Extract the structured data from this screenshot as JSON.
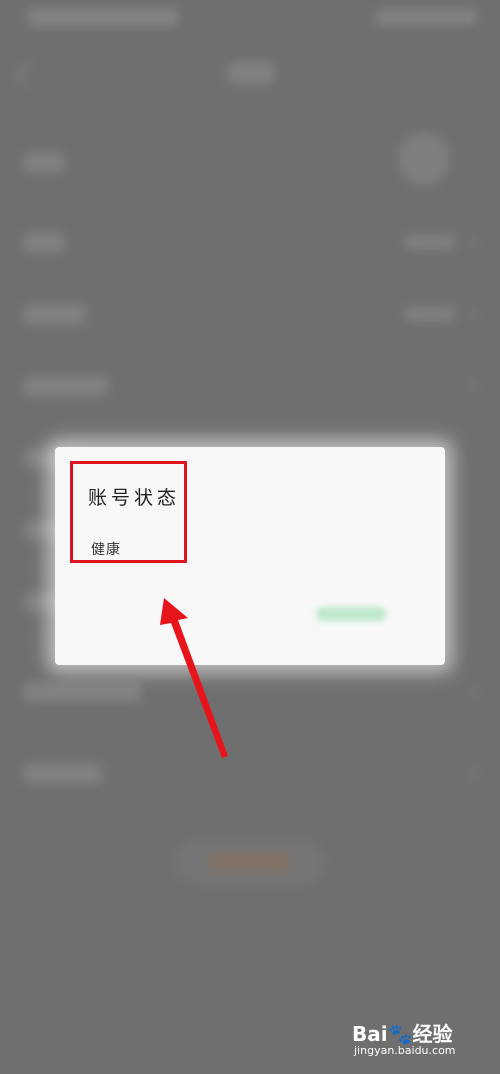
{
  "dialog": {
    "title": "账号状态",
    "status_value": "健康"
  },
  "watermark": {
    "logo_text": "Bai🐾经验",
    "url": "jingyan.baidu.com"
  },
  "colors": {
    "highlight": "#e0141e",
    "arrow": "#e8141c",
    "dialog_button_tint": "#bfe8cf"
  },
  "icons": {
    "back": "back-chevron-icon",
    "row_chevron": "chevron-right-icon",
    "annotation_arrow": "arrow-up-icon"
  }
}
